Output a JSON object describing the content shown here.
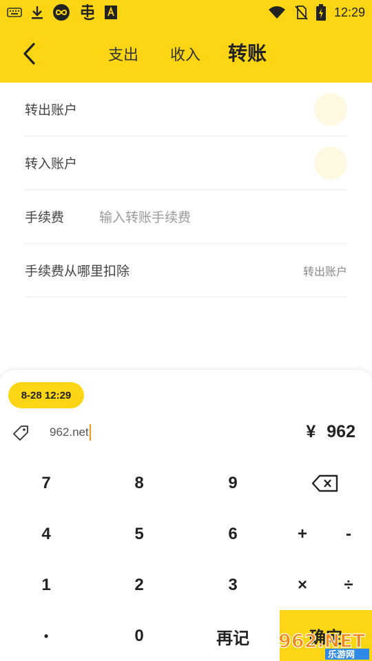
{
  "status_bar": {
    "time": "12:29",
    "icons": [
      "keyboard-icon",
      "download-icon",
      "infinity-badge-icon",
      "bug-app-icon",
      "font-a-icon",
      "wifi-icon",
      "no-sim-icon",
      "battery-charging-icon"
    ]
  },
  "nav": {
    "tabs": [
      {
        "label": "支出",
        "active": false
      },
      {
        "label": "收入",
        "active": false
      },
      {
        "label": "转账",
        "active": true
      }
    ]
  },
  "form": {
    "out_account_label": "转出账户",
    "in_account_label": "转入账户",
    "fee_label": "手续费",
    "fee_placeholder": "输入转账手续费",
    "deduct_label": "手续费从哪里扣除",
    "deduct_value": "转出账户"
  },
  "keypad": {
    "date": "8-28 12:29",
    "note_value": "962.net",
    "currency": "¥",
    "amount": "962",
    "keys": {
      "k7": "7",
      "k8": "8",
      "k9": "9",
      "k4": "4",
      "k5": "5",
      "k6": "6",
      "plus": "+",
      "minus": "-",
      "k1": "1",
      "k2": "2",
      "k3": "3",
      "times": "×",
      "divide": "÷",
      "dot": "•",
      "k0": "0",
      "again": "再记"
    },
    "confirm": "确定"
  },
  "watermark": {
    "brand": "962.NET",
    "sub": "乐游网"
  },
  "colors": {
    "accent": "#fcd615",
    "account_circle": "#fff8e3",
    "caret": "#f39a1e"
  }
}
